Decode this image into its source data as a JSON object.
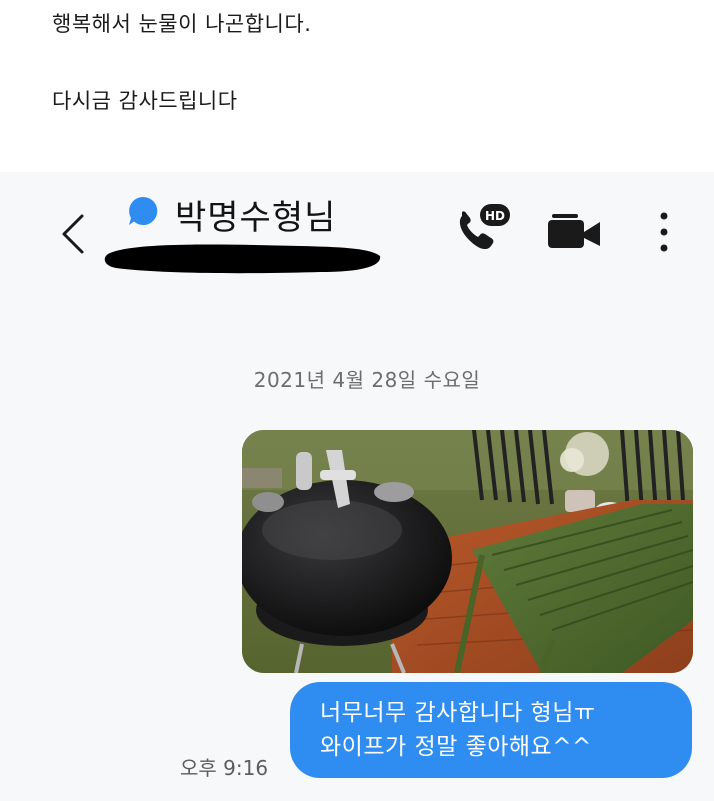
{
  "post": {
    "line1": "행복해서 눈물이 나곤합니다.",
    "line2": "다시금 감사드립니다"
  },
  "header": {
    "contact_name": "박명수형님",
    "hd_badge": "HD"
  },
  "conversation": {
    "date": "2021년 4월 28일 수요일",
    "message_lines": [
      "너무너무 감사합니다 형님ㅠ",
      "와이프가 정말 좋아해요^^"
    ],
    "timestamp": "오후 9:16"
  },
  "colors": {
    "accent_blue": "#2f8df2",
    "chat_background": "#f7f8fa",
    "text_dark": "#141414"
  },
  "icons": [
    "back-arrow",
    "presence-dot",
    "hd-call",
    "video-call",
    "more-vertical"
  ]
}
